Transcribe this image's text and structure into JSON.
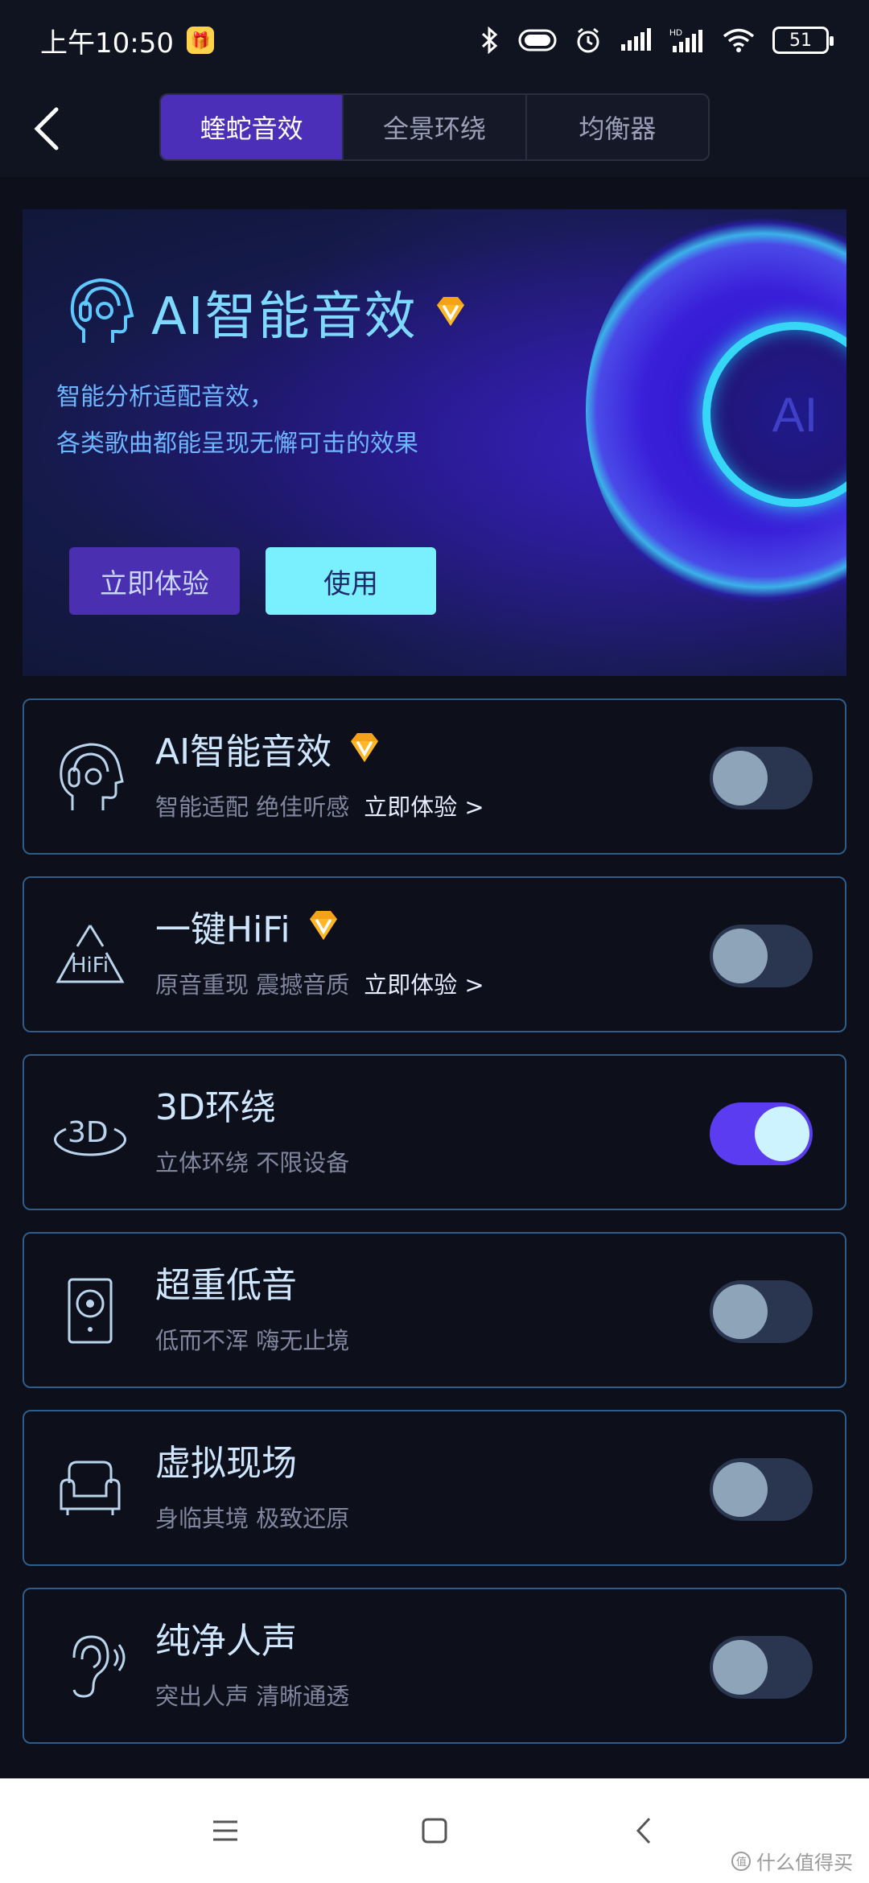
{
  "status_bar": {
    "time": "上午10:50",
    "app_badge": "🎁",
    "battery": "51",
    "icons": [
      "bluetooth-icon",
      "toggle-icon",
      "alarm-icon",
      "signal-icon",
      "hd-signal-icon",
      "wifi-icon",
      "battery-icon"
    ]
  },
  "header": {
    "tabs": [
      "蝰蛇音效",
      "全景环绕",
      "均衡器"
    ],
    "active_tab": 0
  },
  "banner": {
    "title": "AI智能音效",
    "desc_line1": "智能分析适配音效，",
    "desc_line2": "各类歌曲都能呈现无懈可击的效果",
    "ring_text": "AI",
    "try_label": "立即体验",
    "use_label": "使用"
  },
  "effects": [
    {
      "title": "AI智能音效",
      "sub": "智能适配 绝佳听感",
      "link": "立即体验 >",
      "vip": true,
      "on": false,
      "icon": "ai-head-icon"
    },
    {
      "title": "一键HiFi",
      "sub": "原音重现 震撼音质",
      "link": "立即体验 >",
      "vip": true,
      "on": false,
      "icon": "hifi-icon"
    },
    {
      "title": "3D环绕",
      "sub": "立体环绕 不限设备",
      "link": "",
      "vip": false,
      "on": true,
      "icon": "3d-icon"
    },
    {
      "title": "超重低音",
      "sub": "低而不浑 嗨无止境",
      "link": "",
      "vip": false,
      "on": false,
      "icon": "speaker-icon"
    },
    {
      "title": "虚拟现场",
      "sub": "身临其境 极致还原",
      "link": "",
      "vip": false,
      "on": false,
      "icon": "sofa-icon"
    },
    {
      "title": "纯净人声",
      "sub": "突出人声 清晰通透",
      "link": "",
      "vip": false,
      "on": false,
      "icon": "ear-icon"
    }
  ],
  "watermark": "什么值得买",
  "hifi_icon_text": "HiFi",
  "three_d_icon_text": "3D",
  "colors": {
    "accent": "#4b2fb8",
    "toggle_on": "#5b3cf0",
    "card_border": "#2e5d8a",
    "vip_gold": "#f4a21a"
  }
}
